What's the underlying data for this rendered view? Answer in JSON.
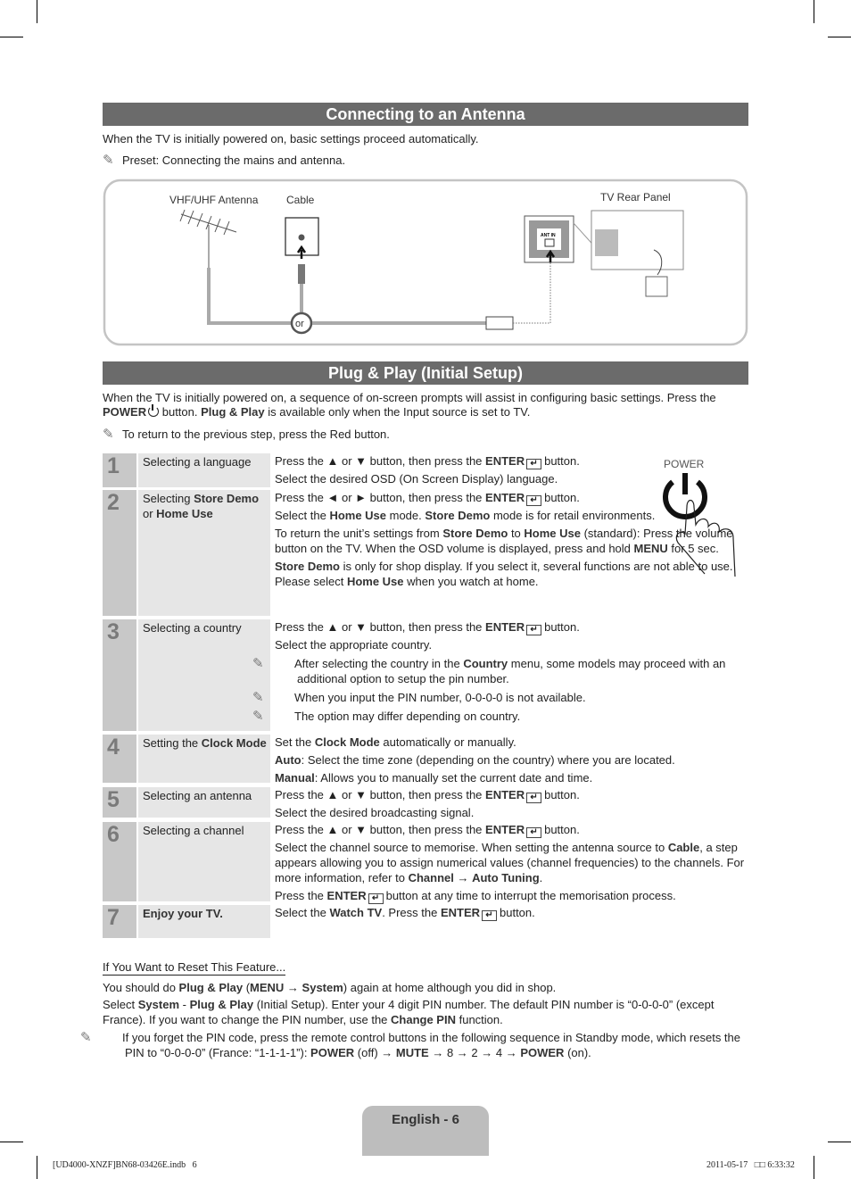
{
  "antenna_section": {
    "title": "Connecting to an Antenna",
    "intro": "When the TV is initially powered on, basic settings proceed automatically.",
    "note": "Preset: Connecting the mains and antenna.",
    "diagram": {
      "antenna_label": "VHF/UHF Antenna",
      "cable_label": "Cable",
      "rear_panel_label": "TV Rear Panel",
      "or_label": "or",
      "port_label": "ANT IN"
    }
  },
  "plug_section": {
    "title": "Plug & Play (Initial Setup)",
    "intro": [
      {
        "t": "When the TV is initially powered on, a sequence of on-screen prompts will assist in configuring basic settings. Press the "
      },
      {
        "t": "POWER",
        "b": true
      },
      {
        "icon": "power-icon"
      },
      {
        "t": " button. "
      },
      {
        "t": "Plug & Play",
        "b": true
      },
      {
        "t": " is available only when the Input source is set to TV."
      }
    ],
    "note": "To return to the previous step, press the Red button.",
    "power_label": "POWER",
    "steps": [
      {
        "num": "1",
        "label": [
          {
            "t": "Selecting a language"
          }
        ],
        "content": [
          [
            {
              "t": "Press the ▲ or ▼ button, then press the "
            },
            {
              "t": "ENTER",
              "b": true
            },
            {
              "icon": "enter-icon"
            },
            {
              "t": "button."
            }
          ],
          [
            {
              "t": "Select the desired OSD (On Screen Display) language."
            }
          ]
        ]
      },
      {
        "num": "2",
        "label": [
          {
            "t": "Selecting "
          },
          {
            "t": "Store Demo",
            "b": true
          },
          {
            "t": " or "
          },
          {
            "t": "Home Use",
            "b": true
          }
        ],
        "content": [
          [
            {
              "t": "Press the ◄ or ► button, then press the "
            },
            {
              "t": "ENTER",
              "b": true
            },
            {
              "icon": "enter-icon"
            },
            {
              "t": "button."
            }
          ],
          [
            {
              "t": "Select the "
            },
            {
              "t": "Home Use",
              "b": true
            },
            {
              "t": " mode. "
            },
            {
              "t": "Store Demo",
              "b": true
            },
            {
              "t": " mode is for retail environments."
            }
          ],
          [
            {
              "t": "To return the unit’s settings from "
            },
            {
              "t": "Store Demo",
              "b": true
            },
            {
              "t": " to "
            },
            {
              "t": "Home Use",
              "b": true
            },
            {
              "t": " (standard): Press the volume button on the TV. When the OSD volume is displayed, press and hold "
            },
            {
              "t": "MENU",
              "b": true
            },
            {
              "t": " for 5 sec."
            }
          ],
          [
            {
              "t": "Store Demo",
              "b": true
            },
            {
              "t": " is only for shop display. If you select it, several functions are not able to use. Please select "
            },
            {
              "t": "Home Use",
              "b": true
            },
            {
              "t": " when you watch at home."
            }
          ]
        ]
      },
      {
        "num": "3",
        "label": [
          {
            "t": "Selecting a country"
          }
        ],
        "content": [
          [
            {
              "t": "Press the ▲ or ▼ button, then press the "
            },
            {
              "t": "ENTER",
              "b": true
            },
            {
              "icon": "enter-icon"
            },
            {
              "t": "button."
            }
          ],
          [
            {
              "t": "Select the appropriate country."
            }
          ],
          [
            {
              "note": true
            },
            {
              "t": "After selecting the country in the "
            },
            {
              "t": "Country",
              "b": true
            },
            {
              "t": " menu, some models may proceed with an additional option to setup the pin number."
            }
          ],
          [
            {
              "note": true
            },
            {
              "t": "When you input the PIN number, 0-0-0-0 is not available."
            }
          ],
          [
            {
              "note": true
            },
            {
              "t": "The option may differ depending on country."
            }
          ]
        ]
      },
      {
        "num": "4",
        "label": [
          {
            "t": "Setting the "
          },
          {
            "t": "Clock Mode",
            "b": true
          }
        ],
        "content": [
          [
            {
              "t": "Set the "
            },
            {
              "t": "Clock Mode",
              "b": true
            },
            {
              "t": " automatically or manually."
            }
          ],
          [
            {
              "t": "Auto",
              "b": true
            },
            {
              "t": ": Select the time zone (depending on the country) where you are located."
            }
          ],
          [
            {
              "t": "Manual",
              "b": true
            },
            {
              "t": ": Allows you to manually set the current date and time."
            }
          ]
        ]
      },
      {
        "num": "5",
        "label": [
          {
            "t": "Selecting an antenna"
          }
        ],
        "content": [
          [
            {
              "t": "Press the ▲ or ▼ button, then press the "
            },
            {
              "t": "ENTER",
              "b": true
            },
            {
              "icon": "enter-icon"
            },
            {
              "t": "button."
            }
          ],
          [
            {
              "t": "Select the desired broadcasting signal."
            }
          ]
        ]
      },
      {
        "num": "6",
        "label": [
          {
            "t": "Selecting a channel"
          }
        ],
        "content": [
          [
            {
              "t": "Press the ▲ or ▼ button, then press the "
            },
            {
              "t": "ENTER",
              "b": true
            },
            {
              "icon": "enter-icon"
            },
            {
              "t": "button."
            }
          ],
          [
            {
              "t": "Select the channel source to memorise. When setting the antenna source to "
            },
            {
              "t": "Cable",
              "b": true
            },
            {
              "t": ", a step appears allowing you to assign numerical values (channel frequencies) to the channels. For more information, refer to "
            },
            {
              "t": "Channel",
              "b": true
            },
            {
              "t": " → "
            },
            {
              "t": "Auto Tuning",
              "b": true
            },
            {
              "t": "."
            }
          ],
          [
            {
              "t": "Press the "
            },
            {
              "t": "ENTER",
              "b": true
            },
            {
              "icon": "enter-icon"
            },
            {
              "t": "button at any time to interrupt the memorisation process."
            }
          ]
        ]
      },
      {
        "num": "7",
        "label": [
          {
            "t": "Enjoy your TV.",
            "b": true
          }
        ],
        "content": [
          [
            {
              "t": "Select the "
            },
            {
              "t": "Watch TV",
              "b": true
            },
            {
              "t": ". Press the "
            },
            {
              "t": "ENTER",
              "b": true
            },
            {
              "icon": "enter-icon"
            },
            {
              "t": "button."
            }
          ]
        ]
      }
    ]
  },
  "reset_section": {
    "heading": "If You Want to Reset This Feature...",
    "paragraphs": [
      [
        {
          "t": "You should do "
        },
        {
          "t": "Plug & Play",
          "b": true
        },
        {
          "t": " ("
        },
        {
          "t": "MENU",
          "b": true
        },
        {
          "t": " → "
        },
        {
          "t": "System",
          "b": true
        },
        {
          "t": ") again at home although you did in shop."
        }
      ],
      [
        {
          "t": "Select "
        },
        {
          "t": "System",
          "b": true
        },
        {
          "t": " - "
        },
        {
          "t": "Plug & Play",
          "b": true
        },
        {
          "t": " (Initial Setup). Enter your 4 digit PIN number. The default PIN number is “0-0-0-0” (except France). If you want to change the PIN number, use the "
        },
        {
          "t": "Change PIN",
          "b": true
        },
        {
          "t": " function."
        }
      ],
      [
        {
          "note": true
        },
        {
          "t": "If you forget the PIN code, press the remote control buttons in the following sequence in Standby mode, which resets the PIN to “0-0-0-0” (France: “1-1-1-1”): "
        },
        {
          "t": "POWER",
          "b": true
        },
        {
          "t": " (off) → "
        },
        {
          "t": "MUTE",
          "b": true
        },
        {
          "t": " → 8 → 2 → 4 → "
        },
        {
          "t": "POWER",
          "b": true
        },
        {
          "t": " (on)."
        }
      ]
    ]
  },
  "footer": {
    "page_label": "English - 6",
    "file_info": "[UD4000-XNZF]BN68-03426E.indb   6",
    "timestamp": "2011-05-17   □□ 6:33:32"
  }
}
